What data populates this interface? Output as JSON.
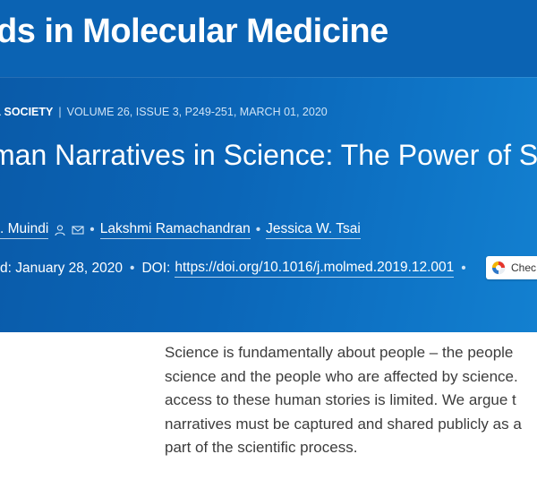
{
  "journal": {
    "title": "ds in Molecular Medicine"
  },
  "meta": {
    "section": "& SOCIETY",
    "volume_info": "VOLUME 26, ISSUE 3, P249-251, MARCH 01, 2020"
  },
  "article": {
    "title": "man Narratives in Science: The Power of Sto"
  },
  "authors": [
    {
      "name": ". Muindi"
    },
    {
      "name": "Lakshmi Ramachandran"
    },
    {
      "name": "Jessica W. Tsai"
    }
  ],
  "publication": {
    "date_text": "d: January 28, 2020",
    "doi_label": "DOI:",
    "doi_url": "https://doi.org/10.1016/j.molmed.2019.12.001"
  },
  "check_updates": {
    "label": "Chec"
  },
  "abstract": {
    "lines": [
      "Science is fundamentally about people – the people",
      "science and the people who are affected by science.",
      "access to these human stories is limited. We argue t",
      "narratives must be captured and shared publicly as a",
      "part of the scientific process."
    ]
  },
  "icons": {
    "author_person": "person-icon",
    "author_email": "envelope-icon",
    "check_updates": "crossmark-icon"
  },
  "colors": {
    "hero_background": "#0b66b8",
    "text_on_hero": "#ffffff",
    "body_text": "#3c3c3c"
  }
}
